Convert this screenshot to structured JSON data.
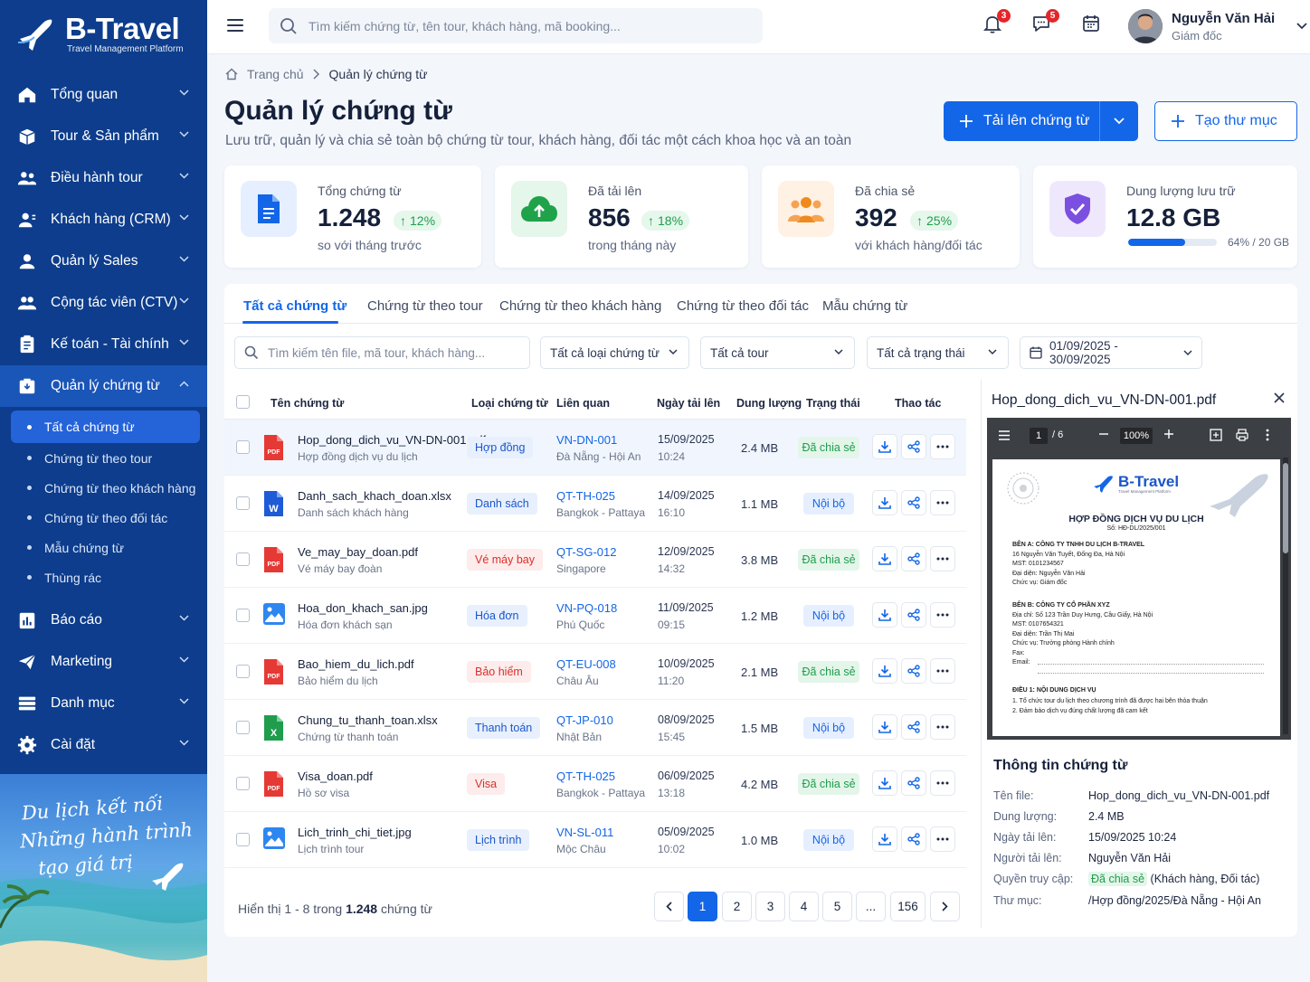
{
  "brand": {
    "name": "B-Travel",
    "tagline": "Travel Management Platform"
  },
  "sidebar": {
    "items": [
      {
        "label": "Tổng quan",
        "icon": "home-icon"
      },
      {
        "label": "Tour & Sản phẩm",
        "icon": "box-icon"
      },
      {
        "label": "Điều hành tour",
        "icon": "team-icon"
      },
      {
        "label": "Khách hàng (CRM)",
        "icon": "customer-icon"
      },
      {
        "label": "Quản lý Sales",
        "icon": "sales-icon"
      },
      {
        "label": "Cộng tác viên (CTV)",
        "icon": "partner-icon"
      },
      {
        "label": "Kế toán - Tài chính",
        "icon": "ledger-icon"
      },
      {
        "label": "Quản lý chứng từ",
        "icon": "document-icon"
      },
      {
        "label": "Báo cáo",
        "icon": "chart-icon"
      },
      {
        "label": "Marketing",
        "icon": "send-icon"
      },
      {
        "label": "Danh mục",
        "icon": "list-icon"
      },
      {
        "label": "Cài đặt",
        "icon": "gear-icon"
      }
    ],
    "sub_items": [
      "Tất cả chứng từ",
      "Chứng từ theo tour",
      "Chứng từ theo khách hàng",
      "Chứng từ theo đối tác",
      "Mẫu chứng từ",
      "Thùng rác"
    ],
    "promo_lines": [
      "Du lịch kết nối",
      "Những hành trình",
      "tạo giá trị"
    ]
  },
  "topbar": {
    "search_placeholder": "Tìm kiếm chứng từ, tên tour, khách hàng, mã booking...",
    "notif_count": "3",
    "message_count": "5",
    "user_name": "Nguyễn Văn Hải",
    "user_role": "Giám đốc"
  },
  "breadcrumb": {
    "home": "Trang chủ",
    "current": "Quản lý chứng từ"
  },
  "page": {
    "title": "Quản lý chứng từ",
    "subtitle": "Lưu trữ, quản lý và chia sẻ toàn bộ chứng từ tour, khách hàng, đối tác một cách khoa học và an toàn",
    "upload_label": "Tải lên chứng từ",
    "folder_label": "Tạo thư mục"
  },
  "stats": [
    {
      "label": "Tổng chứng từ",
      "value": "1.248",
      "trend": "12%",
      "note": "so với tháng trước",
      "color": "#1366e8"
    },
    {
      "label": "Đã tải lên",
      "value": "856",
      "trend": "18%",
      "note": "trong tháng này",
      "color": "#1fa24a"
    },
    {
      "label": "Đã chia sẻ",
      "value": "392",
      "trend": "25%",
      "note": "với khách hàng/đối tác",
      "color": "#f08a1c"
    },
    {
      "label": "Dung lượng lưu trữ",
      "value": "12.8 GB",
      "usage_text": "64% / 20 GB",
      "usage_fraction": 0.64,
      "color": "#7b4fe0"
    }
  ],
  "tabs": [
    "Tất cả chứng từ",
    "Chứng từ theo tour",
    "Chứng từ theo khách hàng",
    "Chứng từ theo đối tác",
    "Mẫu chứng từ"
  ],
  "filters": {
    "search_placeholder": "Tìm kiếm tên file, mã tour, khách hàng...",
    "type": "Tất cả loại chứng từ",
    "tour": "Tất cả tour",
    "status": "Tất cả trạng thái",
    "date_range": "01/09/2025 - 30/09/2025"
  },
  "table": {
    "columns": [
      "Tên chứng từ",
      "Loại chứng từ",
      "Liên quan",
      "Ngày tải lên",
      "Dung lượng",
      "Trạng thái",
      "Thao tác"
    ],
    "rows": [
      {
        "file": "Hop_dong_dich_vu_VN-DN-001.pdf",
        "desc": "Hợp đồng dịch vụ du lịch",
        "type": "Hợp đồng",
        "code": "VN-DN-001",
        "place": "Đà Nẵng - Hội An",
        "date": "15/09/2025",
        "time": "10:24",
        "size": "2.4 MB",
        "status": "Đã chia sẻ",
        "kind": "pdf",
        "tcolor": "blue",
        "scolor": "shared"
      },
      {
        "file": "Danh_sach_khach_doan.xlsx",
        "desc": "Danh sách khách hàng",
        "type": "Danh sách",
        "code": "QT-TH-025",
        "place": "Bangkok - Pattaya",
        "date": "14/09/2025",
        "time": "16:10",
        "size": "1.1 MB",
        "status": "Nội bộ",
        "kind": "word",
        "tcolor": "blue",
        "scolor": "internal"
      },
      {
        "file": "Ve_may_bay_doan.pdf",
        "desc": "Vé máy bay đoàn",
        "type": "Vé máy bay",
        "code": "QT-SG-012",
        "place": "Singapore",
        "date": "12/09/2025",
        "time": "14:32",
        "size": "3.8 MB",
        "status": "Đã chia sẻ",
        "kind": "pdf",
        "tcolor": "red",
        "scolor": "shared"
      },
      {
        "file": "Hoa_don_khach_san.jpg",
        "desc": "Hóa đơn khách sạn",
        "type": "Hóa đơn",
        "code": "VN-PQ-018",
        "place": "Phú Quốc",
        "date": "11/09/2025",
        "time": "09:15",
        "size": "1.2 MB",
        "status": "Nội bộ",
        "kind": "image",
        "tcolor": "blue",
        "scolor": "internal"
      },
      {
        "file": "Bao_hiem_du_lich.pdf",
        "desc": "Bảo hiểm du lịch",
        "type": "Bảo hiểm",
        "code": "QT-EU-008",
        "place": "Châu Âu",
        "date": "10/09/2025",
        "time": "11:20",
        "size": "2.1 MB",
        "status": "Đã chia sẻ",
        "kind": "pdf",
        "tcolor": "red",
        "scolor": "shared"
      },
      {
        "file": "Chung_tu_thanh_toan.xlsx",
        "desc": "Chứng từ thanh toán",
        "type": "Thanh toán",
        "code": "QT-JP-010",
        "place": "Nhật Bản",
        "date": "08/09/2025",
        "time": "15:45",
        "size": "1.5 MB",
        "status": "Nội bộ",
        "kind": "excel",
        "tcolor": "blue",
        "scolor": "internal"
      },
      {
        "file": "Visa_doan.pdf",
        "desc": "Hồ sơ visa",
        "type": "Visa",
        "code": "QT-TH-025",
        "place": "Bangkok - Pattaya",
        "date": "06/09/2025",
        "time": "13:18",
        "size": "4.2 MB",
        "status": "Đã chia sẻ",
        "kind": "pdf",
        "tcolor": "red",
        "scolor": "shared"
      },
      {
        "file": "Lich_trinh_chi_tiet.jpg",
        "desc": "Lịch trình tour",
        "type": "Lịch trình",
        "code": "VN-SL-011",
        "place": "Mộc Châu",
        "date": "05/09/2025",
        "time": "10:02",
        "size": "1.0 MB",
        "status": "Nội bộ",
        "kind": "image",
        "tcolor": "blue",
        "scolor": "internal"
      }
    ]
  },
  "pagination": {
    "info_prefix": "Hiển thị 1 - 8 trong ",
    "info_total": "1.248",
    "info_suffix": " chứng từ",
    "pages": [
      "1",
      "2",
      "3",
      "4",
      "5",
      "...",
      "156"
    ]
  },
  "preview": {
    "file": "Hop_dong_dich_vu_VN-DN-001.pdf",
    "page": "1",
    "pages": "/ 6",
    "zoom": "100%",
    "doc": {
      "brand": "B-Travel",
      "brand_sub": "Travel Management Platform",
      "title": "HỢP ĐỒNG DỊCH VỤ DU LỊCH",
      "number": "Số: HĐ-DL/2025/001",
      "party_a": [
        "BÊN A: CÔNG TY TNHH DU LỊCH B-TRAVEL",
        "16 Nguyễn Văn Tuyết, Đống Đa, Hà Nội",
        "MST: 0101234567",
        "Đại diện: Nguyễn Văn Hải",
        "Chức vụ: Giám đốc"
      ],
      "party_b": [
        "BÊN B: CÔNG TY CỔ PHẦN XYZ",
        "Địa chỉ: Số 123 Trần Duy Hưng, Cầu Giấy, Hà Nội",
        "MST: 0107654321",
        "Đại diện: Trần Thị Mai",
        "Chức vụ: Trưởng phòng Hành chính",
        "Fax:",
        "Email:"
      ],
      "clause": [
        "ĐIỀU 1: NỘI DUNG DỊCH VỤ",
        "1. Tổ chức tour du lịch theo chương trình đã được hai bên thỏa thuận",
        "2. Đảm bảo dịch vụ đúng chất lượng đã cam kết"
      ]
    },
    "info_title": "Thông tin chứng từ",
    "info": [
      {
        "k": "Tên file:",
        "v": "Hop_dong_dich_vu_VN-DN-001.pdf"
      },
      {
        "k": "Dung lượng:",
        "v": "2.4 MB"
      },
      {
        "k": "Ngày tải lên:",
        "v": "15/09/2025 10:24"
      },
      {
        "k": "Người tải lên:",
        "v": "Nguyễn Văn Hải"
      },
      {
        "k": "Quyền truy cập:",
        "v": "Đã chia sẻ",
        "v2": " (Khách hàng, Đối tác)"
      },
      {
        "k": "Thư mục:",
        "v": "/Hợp đồng/2025/Đà Nẵng - Hội An"
      }
    ]
  }
}
